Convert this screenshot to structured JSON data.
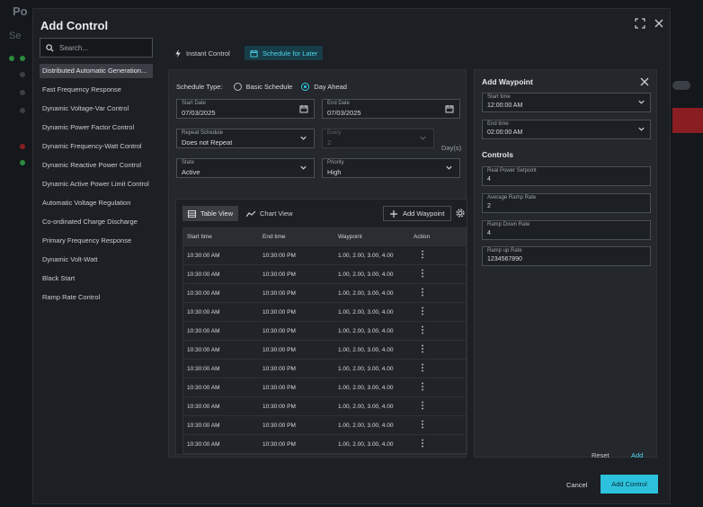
{
  "background": {
    "title": "Po",
    "search": "Se"
  },
  "modal": {
    "title": "Add Control",
    "search_placeholder": "Search...",
    "control_list": [
      "Distributed Automatic Generation...",
      "Fast Frequency Response",
      "Dynamic Voltage-Var Control",
      "Dynamic Power Factor Control",
      "Dynamic Frequency-Watt Control",
      "Dynamic Reactive Power Control",
      "Dynamic Active Power Limit Control",
      "Automatic Voltage Regulation",
      "Co-ordinated Charge Discharge",
      "Primary Frequency Response",
      "Dynamic Volt-Watt",
      "Black Start",
      "Ramp Rate Control"
    ],
    "tabs": {
      "instant": "Instant Control",
      "schedule": "Schedule for Later"
    },
    "form": {
      "schedule_type_label": "Schedule Type:",
      "basic_schedule": "Basic Schedule",
      "day_ahead": "Day Ahead",
      "start_date_label": "Start Date",
      "start_date": "07/03/2025",
      "end_date_label": "End Date",
      "end_date": "07/03/2025",
      "repeat_label": "Repeat Schedule",
      "repeat_value": "Does not Repeat",
      "every_label": "Every",
      "every_value": "2",
      "every_unit": "Day(s)",
      "state_label": "State",
      "state_value": "Active",
      "priority_label": "Priority",
      "priority_value": "High"
    },
    "table": {
      "table_view": "Table View",
      "chart_view": "Chart View",
      "add_waypoint": "Add Waypoint",
      "columns": [
        "Start time",
        "End time",
        "Waypoint",
        "Action"
      ],
      "rows": [
        [
          "10:30:00 AM",
          "10:30:00 PM",
          "1.00, 2.00, 3.00, 4.00"
        ],
        [
          "10:30:00 AM",
          "10:30:00 PM",
          "1.00, 2.00, 3.00, 4.00"
        ],
        [
          "10:30:00 AM",
          "10:30:00 PM",
          "1.00, 2.00, 3.00, 4.00"
        ],
        [
          "10:30:00 AM",
          "10:30:00 PM",
          "1.00, 2.00, 3.00, 4.00"
        ],
        [
          "10:30:00 AM",
          "10:30:00 PM",
          "1.00, 2.00, 3.00, 4.00"
        ],
        [
          "10:30:00 AM",
          "10:30:00 PM",
          "1.00, 2.00, 3.00, 4.00"
        ],
        [
          "10:30:00 AM",
          "10:30:00 PM",
          "1.00, 2.00, 3.00, 4.00"
        ],
        [
          "10:30:00 AM",
          "10:30:00 PM",
          "1.00, 2.00, 3.00, 4.00"
        ],
        [
          "10:30:00 AM",
          "10:30:00 PM",
          "1.00, 2.00, 3.00, 4.00"
        ],
        [
          "10:30:00 AM",
          "10:30:00 PM",
          "1.00, 2.00, 3.00, 4.00"
        ],
        [
          "10:30:00 AM",
          "10:30:00 PM",
          "1.00, 2.00, 3.00, 4.00"
        ]
      ]
    },
    "waypoint": {
      "title": "Add Waypoint",
      "start_time_label": "Start time",
      "start_time": "12:00:00 AM",
      "end_time_label": "End time",
      "end_time": "02:00:00 AM",
      "controls_title": "Controls",
      "real_power_label": "Real Power Setpoint",
      "real_power": "4",
      "avg_ramp_label": "Average Ramp Rate",
      "avg_ramp": "2",
      "ramp_down_label": "Ramp Down Rate",
      "ramp_down": "4",
      "ramp_up_label": "Ramp up Rate",
      "ramp_up": "1234567890",
      "reset": "Reset",
      "add": "Add"
    },
    "footer": {
      "cancel": "Cancel",
      "add_control": "Add Control"
    }
  },
  "colors": {
    "accent": "#2cc2de",
    "accent_text": "#4fd6ee",
    "panel": "#24272b"
  }
}
